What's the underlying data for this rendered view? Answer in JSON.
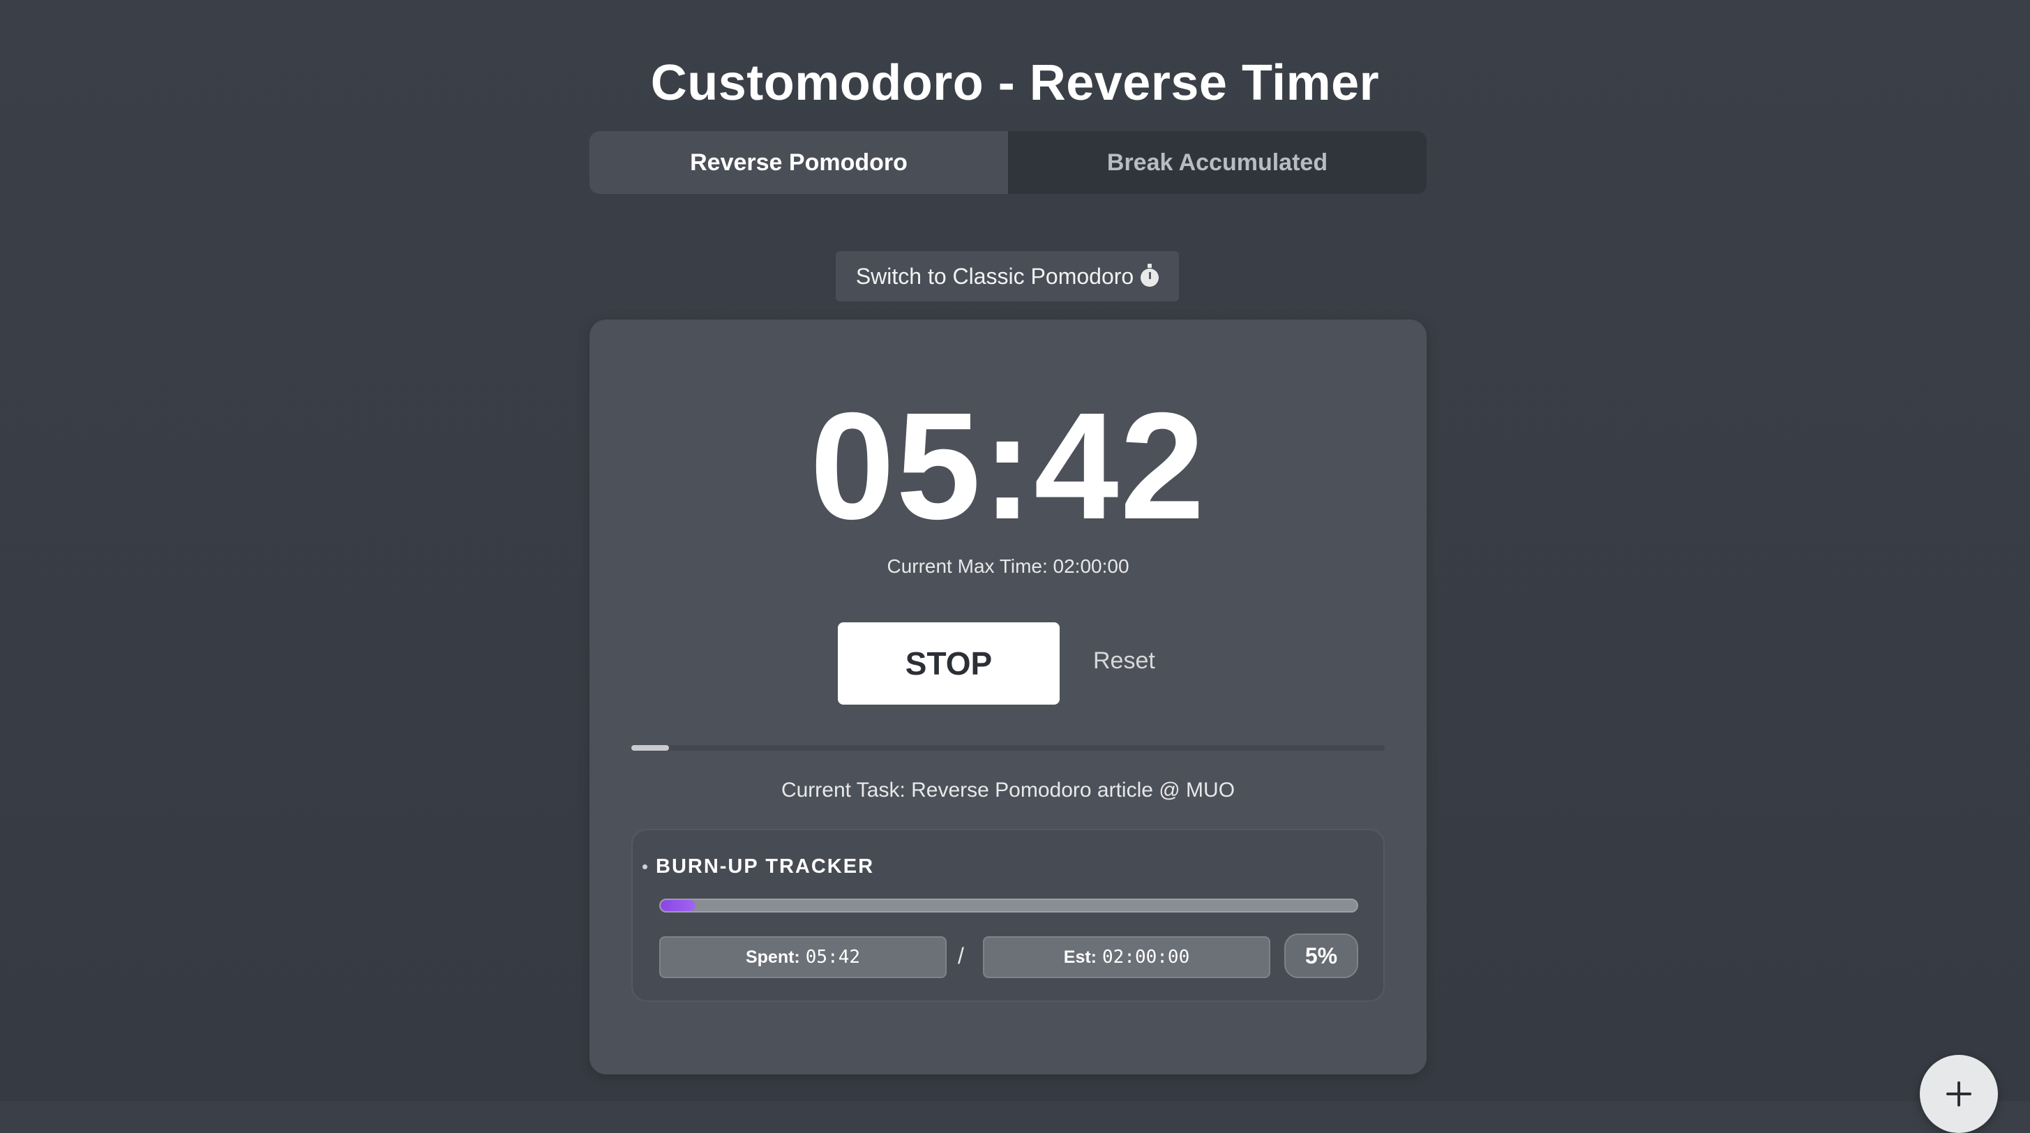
{
  "header": {
    "title": "Customodoro - Reverse Timer"
  },
  "tabs": [
    {
      "label": "Reverse Pomodoro",
      "active": true
    },
    {
      "label": "Break Accumulated",
      "active": false
    }
  ],
  "switch_mode": {
    "label": "Switch to Classic Pomodoro",
    "icon": "stopwatch-icon"
  },
  "timer": {
    "display": "05:42",
    "max_time_text": "Current Max Time: 02:00:00",
    "progress_fraction": 0.05
  },
  "controls": {
    "stop_label": "STOP",
    "reset_label": "Reset"
  },
  "task": {
    "text": "Current Task: Reverse Pomodoro article @ MUO"
  },
  "burnup": {
    "title": "BURN-UP TRACKER",
    "spent_label": "Spent:",
    "spent_value": "05:42",
    "separator": "/",
    "est_label": "Est:",
    "est_value": "02:00:00",
    "percent": "5%",
    "fill_fraction": 0.05,
    "fill_color": "#8a45e6"
  },
  "fab": {
    "icon": "plus-icon"
  },
  "colors": {
    "background": "#3b4048",
    "card": "#4d515a",
    "accent": "#8a45e6"
  }
}
